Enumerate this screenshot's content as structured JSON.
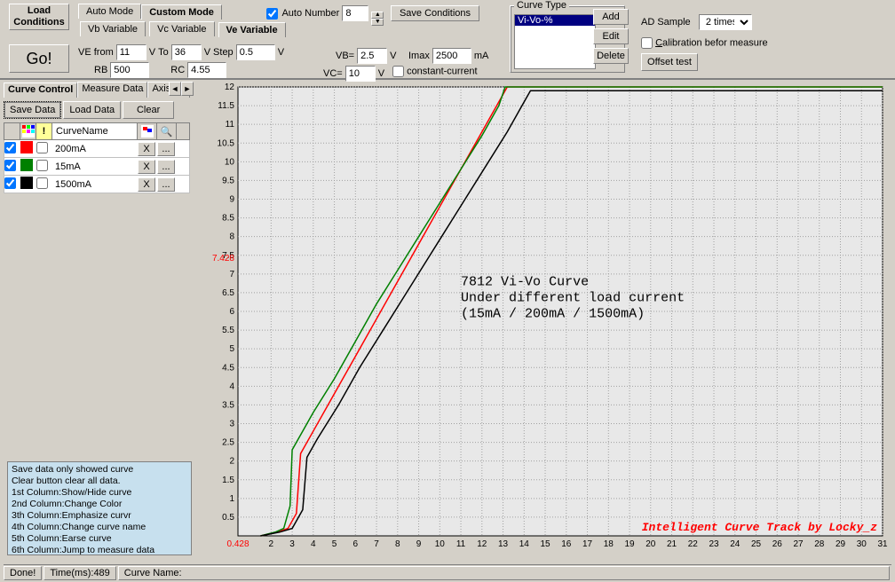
{
  "buttons": {
    "loadConditions": "Load Conditions",
    "go": "Go!",
    "saveConditions": "Save Conditions",
    "add": "Add",
    "edit": "Edit",
    "delete": "Delete",
    "offset": "Offset test",
    "saveData": "Save Data",
    "loadData": "Load Data",
    "clear": "Clear"
  },
  "tabs": {
    "autoMode": "Auto Mode",
    "customMode": "Custom Mode",
    "vb": "Vb Variable",
    "vc": "Vc Variable",
    "ve": "Ve Variable"
  },
  "autoNumber": {
    "label": "Auto Number",
    "value": "8"
  },
  "fields": {
    "veFrom": "VE from",
    "veFromVal": "11",
    "vUnit": "V",
    "to": "To",
    "toVal": "36",
    "step": "Step",
    "stepVal": "0.5",
    "rb": "RB",
    "rbVal": "500",
    "rc": "RC",
    "rcVal": "4.55",
    "vb": "VB=",
    "vbVal": "2.5",
    "imax": "Imax",
    "imaxVal": "2500",
    "mA": "mA",
    "vc": "VC=",
    "vcVal": "10",
    "constantCurrent": "constant-current"
  },
  "curveType": {
    "legend": "Curve Type",
    "items": [
      "Vi-Vo-%"
    ]
  },
  "adSample": {
    "label": "AD Sample",
    "value": "2 times"
  },
  "calibration": "Calibration befor measure",
  "leftTabs": [
    "Curve Control",
    "Measure Data",
    "Axis Co"
  ],
  "curveHeader": "CurveName",
  "curves": [
    {
      "color": "#ff0000",
      "name": "200mA",
      "checked": true
    },
    {
      "color": "#008000",
      "name": "15mA",
      "checked": true
    },
    {
      "color": "#000000",
      "name": "1500mA",
      "checked": true
    }
  ],
  "xBtn": "X",
  "moreBtn": "...",
  "helpLines": [
    " Save data only showed curve",
    " Clear button clear all data.",
    "1st Column:Show/Hide curve",
    "2nd Column:Change Color",
    "3th Column:Emphasize curvr",
    "4th Column:Change curve name",
    "5th Column:Earse curve",
    "6th Column:Jump to measure data"
  ],
  "status": {
    "done": "Done!",
    "time": "Time(ms):489",
    "curveName": "Curve Name:"
  },
  "chart_data": {
    "type": "line",
    "title": "7812 Vi-Vo Curve",
    "subtitle1": "Under different load current",
    "subtitle2": "(15mA / 200mA / 1500mA)",
    "xlabel": "",
    "ylabel": "",
    "xlim": [
      0.428,
      31
    ],
    "ylim": [
      0,
      12
    ],
    "x_highlight": 0.428,
    "y_highlight": 7.428,
    "xticks": [
      2,
      3,
      4,
      5,
      6,
      7,
      8,
      9,
      10,
      11,
      12,
      13,
      14,
      15,
      16,
      17,
      18,
      19,
      20,
      21,
      22,
      23,
      24,
      25,
      26,
      27,
      28,
      29,
      30,
      31
    ],
    "yticks": [
      0.5,
      1,
      1.5,
      2,
      2.5,
      3,
      3.5,
      4,
      4.5,
      5,
      5.5,
      6,
      6.5,
      7,
      7.5,
      8,
      8.5,
      9,
      9.5,
      10,
      10.5,
      11,
      11.5,
      12
    ],
    "watermark": "Intelligent Curve Track by Locky_z",
    "series": [
      {
        "name": "200mA",
        "color": "#ff0000",
        "points": [
          [
            1.5,
            0
          ],
          [
            2.3,
            0.1
          ],
          [
            2.8,
            0.2
          ],
          [
            3.2,
            0.6
          ],
          [
            3.4,
            2.2
          ],
          [
            4,
            2.8
          ],
          [
            5,
            3.8
          ],
          [
            6,
            4.8
          ],
          [
            7,
            5.8
          ],
          [
            8,
            6.8
          ],
          [
            9,
            7.8
          ],
          [
            10,
            8.8
          ],
          [
            11,
            9.8
          ],
          [
            12,
            10.8
          ],
          [
            12.8,
            11.6
          ],
          [
            13.2,
            12
          ],
          [
            31,
            12
          ]
        ]
      },
      {
        "name": "15mA",
        "color": "#008000",
        "points": [
          [
            1.5,
            0
          ],
          [
            2.2,
            0.1
          ],
          [
            2.6,
            0.2
          ],
          [
            2.9,
            0.8
          ],
          [
            3.0,
            2.3
          ],
          [
            4,
            3.3
          ],
          [
            5,
            4.2
          ],
          [
            6,
            5.2
          ],
          [
            7,
            6.2
          ],
          [
            8,
            7.1
          ],
          [
            9,
            8.0
          ],
          [
            10,
            8.9
          ],
          [
            11,
            9.8
          ],
          [
            12,
            10.7
          ],
          [
            12.8,
            11.5
          ],
          [
            13.1,
            12
          ],
          [
            31,
            12
          ]
        ]
      },
      {
        "name": "1500mA",
        "color": "#000000",
        "points": [
          [
            1.5,
            0
          ],
          [
            2.4,
            0.1
          ],
          [
            3.0,
            0.2
          ],
          [
            3.5,
            0.7
          ],
          [
            3.7,
            2.1
          ],
          [
            4.2,
            2.6
          ],
          [
            5.2,
            3.5
          ],
          [
            6.2,
            4.5
          ],
          [
            7.2,
            5.4
          ],
          [
            8.2,
            6.3
          ],
          [
            9.2,
            7.2
          ],
          [
            10.2,
            8.1
          ],
          [
            11.2,
            9.0
          ],
          [
            12.2,
            9.9
          ],
          [
            13.2,
            10.8
          ],
          [
            13.8,
            11.4
          ],
          [
            14.3,
            11.9
          ],
          [
            31,
            11.9
          ]
        ]
      }
    ]
  }
}
